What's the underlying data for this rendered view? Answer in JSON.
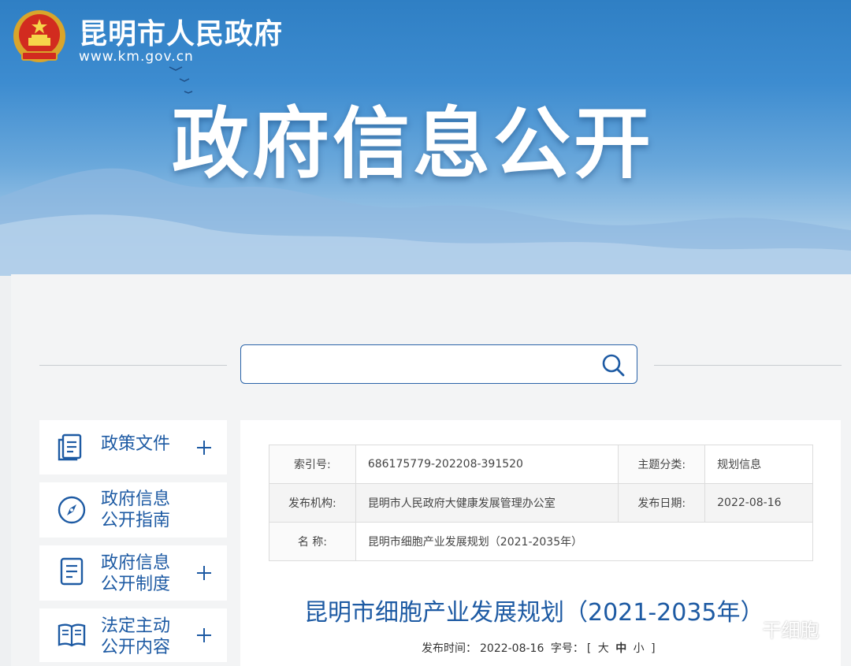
{
  "header": {
    "site_name": "昆明市人民政府",
    "site_url": "www.km.gov.cn",
    "banner_title": "政府信息公开"
  },
  "search": {
    "placeholder": ""
  },
  "sidebar": {
    "items": [
      {
        "label_line1": "政策文件",
        "label_line2": "",
        "icon": "document-icon",
        "expandable": true
      },
      {
        "label_line1": "政府信息",
        "label_line2": "公开指南",
        "icon": "compass-icon",
        "expandable": false
      },
      {
        "label_line1": "政府信息",
        "label_line2": "公开制度",
        "icon": "list-document-icon",
        "expandable": true
      },
      {
        "label_line1": "法定主动",
        "label_line2": "公开内容",
        "icon": "book-icon",
        "expandable": true
      }
    ]
  },
  "meta": {
    "index_label": "索引号:",
    "index_value": "686175779-202208-391520",
    "topic_label": "主题分类:",
    "topic_value": "规划信息",
    "org_label": "发布机构:",
    "org_value": "昆明市人民政府大健康发展管理办公室",
    "date_label": "发布日期:",
    "date_value": "2022-08-16",
    "name_label": "名  称:",
    "name_value": "昆明市细胞产业发展规划（2021-2035年）"
  },
  "article": {
    "title": "昆明市细胞产业发展规划（2021-2035年）",
    "publish_label": "发布时间：",
    "publish_date": "2022-08-16",
    "fontsize_label": "字号：",
    "bracket_open": "[",
    "size_large": "大",
    "size_medium": "中",
    "size_small": "小",
    "bracket_close": "]"
  },
  "watermark": {
    "text": "干细胞"
  },
  "colors": {
    "accent": "#1d5aa3",
    "banner_blue": "#3d8cd0"
  }
}
